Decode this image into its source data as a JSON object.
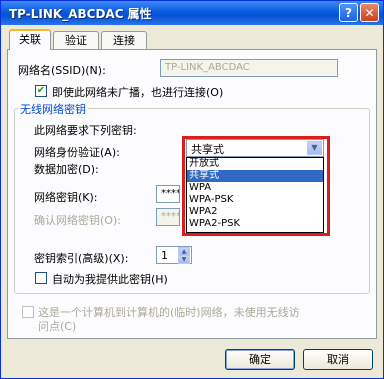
{
  "window": {
    "title": "TP-LINK_ABCDAC 属性",
    "help_glyph": "?",
    "close_glyph": "✕"
  },
  "tabs": [
    {
      "label": "关联",
      "active": true
    },
    {
      "label": "验证",
      "active": false
    },
    {
      "label": "连接",
      "active": false
    }
  ],
  "ssid": {
    "label": "网络名(SSID)(N):",
    "value": "TP-LINK_ABCDAC"
  },
  "broadcast_checkbox": {
    "label": "即使此网络未广播，也进行连接(O)",
    "checked": true,
    "mark": "✔"
  },
  "key_group": {
    "legend": "无线网络密钥",
    "requires_label": "此网络要求下列密钥:",
    "auth_label": "网络身份验证(A):",
    "auth_selected": "共享式",
    "auth_arrow": "▼",
    "auth_options": [
      {
        "label": "开放式",
        "selected": false
      },
      {
        "label": "共享式",
        "selected": true
      },
      {
        "label": "WPA",
        "selected": false
      },
      {
        "label": "WPA-PSK",
        "selected": false
      },
      {
        "label": "WPA2",
        "selected": false
      },
      {
        "label": "WPA2-PSK",
        "selected": false
      }
    ],
    "encryption_label": "数据加密(D):",
    "key_label": "网络密钥(K):",
    "key_value": "****",
    "confirm_label": "确认网络密钥(O):",
    "confirm_value": "****",
    "index_label": "密钥索引(高级)(X):",
    "index_value": "1",
    "index_up": "▲",
    "index_down": "▼",
    "auto_key_label": "自动为我提供此密钥(H)",
    "auto_key_checked": false
  },
  "adhoc": {
    "line1": "这是一个计算机到计算机的(临时)网络，未使用无线访",
    "line2": "问点(C)",
    "checked": false,
    "enabled": false
  },
  "buttons": {
    "ok": "确定",
    "cancel": "取消"
  },
  "colors": {
    "title_bar": "#0a5be0",
    "selection": "#316ac5",
    "highlight_box": "#d81e1e",
    "group_legend": "#0046d5"
  }
}
